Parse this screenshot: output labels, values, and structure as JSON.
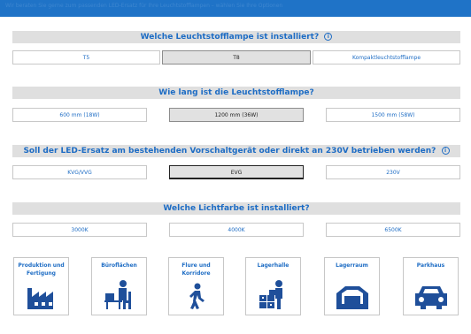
{
  "topbar": {
    "text": "Wir beraten Sie gerne zum passenden LED-Ersatz für Ihre Leuchtstofflampen – wählen Sie Ihre Optionen"
  },
  "sections": [
    {
      "title": "Welche Leuchtstofflampe ist installiert?",
      "info": "i",
      "options": [
        "T5",
        "T8",
        "Kompaktleuchtstofflampe"
      ],
      "selected": "T8"
    },
    {
      "title": "Wie lang ist die Leuchtstofflampe?",
      "options": [
        "600 mm (18W)",
        "1200 mm (36W)",
        "1500 mm (58W)"
      ],
      "selected": "1200 mm (36W)"
    },
    {
      "title": "Soll der LED-Ersatz am bestehenden Vorschaltgerät oder direkt an 230V betrieben werden?",
      "info": "i",
      "options": [
        "KVG/VVG",
        "EVG",
        "230V"
      ],
      "selected": "EVG"
    },
    {
      "title": "Welche Lichtfarbe ist installiert?",
      "options": [
        "3000K",
        "4000K",
        "6500K"
      ],
      "selected": null
    }
  ],
  "categories": [
    {
      "line1": "Produktion und",
      "line2": "Fertigung",
      "icon": "factory-icon"
    },
    {
      "line1": "Büroflächen",
      "line2": "",
      "icon": "office-worker-icon"
    },
    {
      "line1": "Flure und",
      "line2": "Korridore",
      "icon": "walking-person-icon"
    },
    {
      "line1": "Lagerhalle",
      "line2": "",
      "icon": "warehouse-worker-icon"
    },
    {
      "line1": "Lagerraum",
      "line2": "",
      "icon": "storage-room-icon"
    },
    {
      "line1": "Parkhaus",
      "line2": "",
      "icon": "car-icon"
    }
  ],
  "colors": {
    "accent": "#1d6cc4",
    "topbar": "#1f73c7",
    "section_bg": "#dfdfdf",
    "icon": "#1f4f9a"
  }
}
